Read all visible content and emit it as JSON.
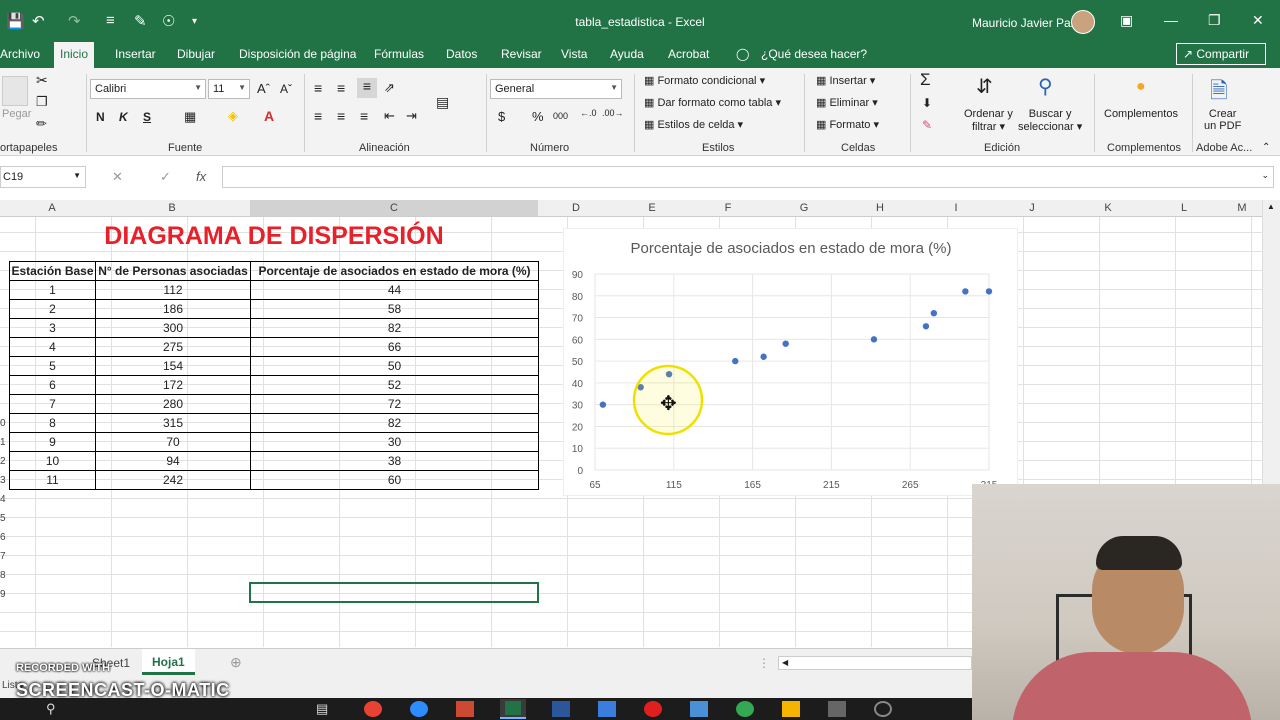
{
  "titlebar": {
    "title": "tabla_estadistica  -  Excel",
    "user": "Mauricio Javier Paz"
  },
  "ribbon_tabs": [
    "Archivo",
    "Inicio",
    "Insertar",
    "Dibujar",
    "Disposición de página",
    "Fórmulas",
    "Datos",
    "Revisar",
    "Vista",
    "Ayuda",
    "Acrobat",
    "¿Qué desea hacer?"
  ],
  "share_label": "Compartir",
  "ribbon": {
    "paste_label": "Pegar",
    "font_name": "Calibri",
    "font_size": "11",
    "number_format": "General",
    "bold": "N",
    "italic": "K",
    "underline": "S",
    "styles": [
      "Formato condicional",
      "Dar formato como tabla",
      "Estilos de celda"
    ],
    "cells": [
      "Insertar",
      "Eliminar",
      "Formato"
    ],
    "sort_label_1": "Ordenar y",
    "sort_label_2": "filtrar",
    "find_label_1": "Buscar y",
    "find_label_2": "seleccionar",
    "complementos_label": "Complementos",
    "pdf_label_1": "Crear",
    "pdf_label_2": "un PDF",
    "groups": [
      "ortapapeles",
      "Fuente",
      "Alineación",
      "Número",
      "Estilos",
      "Celdas",
      "Edición",
      "Complementos",
      "Adobe Ac..."
    ]
  },
  "formula_bar": {
    "name_box": "C19",
    "fx": "fx",
    "content": ""
  },
  "columns": [
    "A",
    "B",
    "C",
    "D",
    "E",
    "F",
    "G",
    "H",
    "I",
    "J",
    "K",
    "L",
    "M"
  ],
  "sheet": {
    "title": "DIAGRAMA DE DISPERSIÓN",
    "headers": [
      "Estación Base",
      "N° de Personas asociadas",
      "Porcentaje de asociados en estado de mora (%)"
    ],
    "rows": [
      [
        "1",
        "112",
        "44"
      ],
      [
        "2",
        "186",
        "58"
      ],
      [
        "3",
        "300",
        "82"
      ],
      [
        "4",
        "275",
        "66"
      ],
      [
        "5",
        "154",
        "50"
      ],
      [
        "6",
        "172",
        "52"
      ],
      [
        "7",
        "280",
        "72"
      ],
      [
        "8",
        "315",
        "82"
      ],
      [
        "9",
        "70",
        "30"
      ],
      [
        "10",
        "94",
        "38"
      ],
      [
        "11",
        "242",
        "60"
      ]
    ]
  },
  "chart_data": {
    "type": "scatter",
    "title": "Porcentaje de asociados en estado de mora (%)",
    "xlabel": "",
    "ylabel": "",
    "x": [
      112,
      186,
      300,
      275,
      154,
      172,
      280,
      315,
      70,
      94,
      242
    ],
    "y": [
      44,
      58,
      82,
      66,
      50,
      52,
      72,
      82,
      30,
      38,
      60
    ],
    "xlim": [
      65,
      315
    ],
    "ylim": [
      0,
      90
    ],
    "xticks": [
      "65",
      "115",
      "165",
      "215",
      "265",
      "315"
    ],
    "yticks": [
      "0",
      "10",
      "20",
      "30",
      "40",
      "50",
      "60",
      "70",
      "80",
      "90"
    ],
    "grid": true,
    "color": "#4472c4"
  },
  "sheet_tabs": [
    "Sheet1",
    "Hoja1"
  ],
  "active_sheet": "Hoja1",
  "status_text": "Listo",
  "watermark": {
    "line1": "RECORDED WITH",
    "line2": "SCREENCAST-O-MATIC"
  },
  "colors": {
    "excel_green": "#217346",
    "title_red": "#e8202a",
    "marker": "#4472c4"
  }
}
